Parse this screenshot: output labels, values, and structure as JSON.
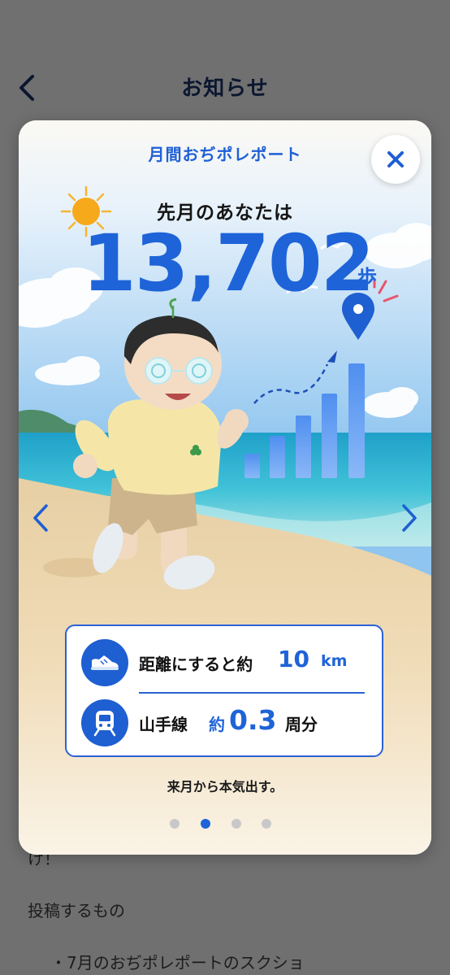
{
  "page": {
    "title": "お知らせ",
    "background_fragment": "け！",
    "background_line1": "投稿するもの",
    "background_line2": "・7月のおぢポレポートのスクショ"
  },
  "modal": {
    "title": "月間おぢポレポート",
    "subtitle": "先月のあなたは",
    "steps_value": "13,702",
    "steps_unit": "歩",
    "distance": {
      "label": "距離にすると約",
      "value": "10",
      "unit": "km",
      "icon": "sneaker-icon"
    },
    "yamanote": {
      "label": "山手線",
      "prefix": "約",
      "value": "0.3",
      "unit": "周分",
      "icon": "train-icon"
    },
    "caption": "来月から本気出す。",
    "pagination": {
      "count": 4,
      "active": 2
    }
  },
  "colors": {
    "accent": "#1e63d8",
    "overlay": "#707070",
    "card_border": "#2a62d4"
  }
}
